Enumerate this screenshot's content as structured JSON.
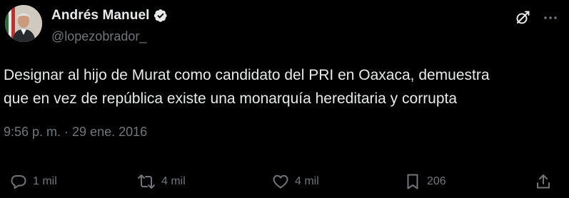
{
  "author": {
    "display_name": "Andrés Manuel",
    "handle": "@lopezobrador_",
    "verified": true
  },
  "tweet": {
    "text": "Designar al hijo de Murat como candidato del PRI en Oaxaca, demuestra\nque en vez de república existe una monarquía hereditaria y corrupta",
    "timestamp": "9:56 p. m. · 29 ene. 2016"
  },
  "actions": {
    "reply_count": "1 mil",
    "retweet_count": "4 mil",
    "like_count": "4 mil",
    "bookmark_count": "206"
  },
  "icons": {
    "verified": "verified-badge-icon",
    "grok": "grok-icon",
    "more": "more-icon",
    "reply": "reply-icon",
    "retweet": "retweet-icon",
    "like": "heart-icon",
    "bookmark": "bookmark-icon",
    "share": "share-icon"
  },
  "colors": {
    "background": "#000000",
    "primary_text": "#e7e9ea",
    "secondary_text": "#71767b",
    "verified_badge": "#e7e9ea"
  }
}
